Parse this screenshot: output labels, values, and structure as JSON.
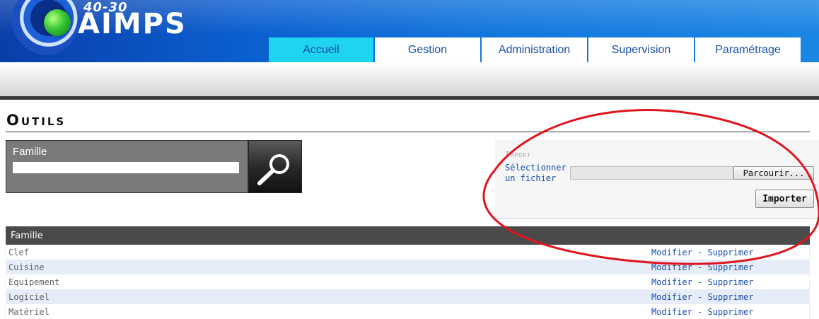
{
  "header": {
    "logo_sub": "40-30",
    "logo_main": "AIMPS"
  },
  "nav": {
    "tabs": [
      {
        "label": "Accueil",
        "active": true
      },
      {
        "label": "Gestion",
        "active": false
      },
      {
        "label": "Administration",
        "active": false
      },
      {
        "label": "Supervision",
        "active": false
      },
      {
        "label": "Paramétrage",
        "active": false
      }
    ]
  },
  "page": {
    "title": "Outils"
  },
  "search": {
    "label": "Famille",
    "value": "",
    "icon": "magnifier-icon"
  },
  "import": {
    "heading": "Import",
    "file_label": "Sélectionner un fichier",
    "browse_label": "Parcourir...",
    "submit_label": "Importer"
  },
  "table": {
    "header": "Famille",
    "separator": " - ",
    "modify_label": "Modifier",
    "delete_label": "Supprimer",
    "rows": [
      "Clef",
      "Cuisine",
      "Equipement",
      "Logiciel",
      "Matériel"
    ]
  },
  "colors": {
    "accent": "#1a4fa8",
    "active_tab": "#1fd4f0",
    "annotation": "#e0141e"
  }
}
